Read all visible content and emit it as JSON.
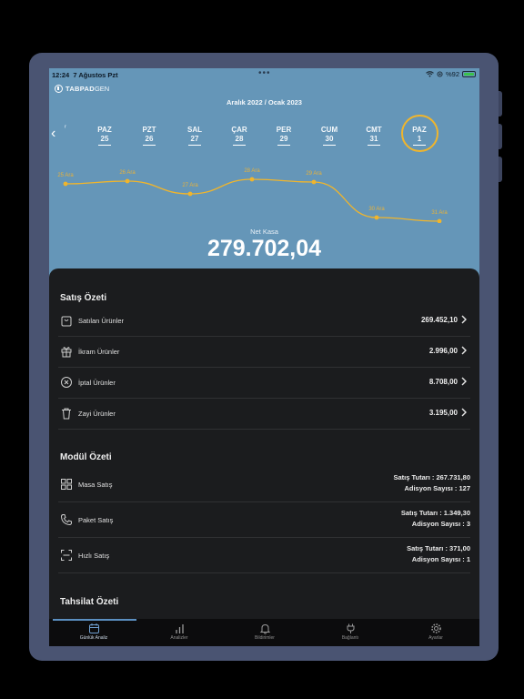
{
  "status_bar": {
    "time": "12:24",
    "date": "7 Ağustos Pzt",
    "battery": "%92",
    "more_dots": "•••"
  },
  "brand": {
    "logo_bold": "TABPAD",
    "logo_light": "GEN"
  },
  "header": {
    "period": "Aralık 2022 / Ocak 2023"
  },
  "days": [
    {
      "name": "",
      "num": "",
      "partial": "ʳ"
    },
    {
      "name": "PAZ",
      "num": "25"
    },
    {
      "name": "PZT",
      "num": "26"
    },
    {
      "name": "SAL",
      "num": "27"
    },
    {
      "name": "ÇAR",
      "num": "28"
    },
    {
      "name": "PER",
      "num": "29"
    },
    {
      "name": "CUM",
      "num": "30"
    },
    {
      "name": "CMT",
      "num": "31"
    },
    {
      "name": "PAZ",
      "num": "1",
      "selected": true
    }
  ],
  "trend_labels": [
    "25 Ara",
    "26 Ara",
    "27 Ara",
    "28 Ara",
    "29 Ara",
    "30 Ara",
    "31 Ara"
  ],
  "net_kasa": {
    "label": "Net Kasa",
    "value": "279.702,04"
  },
  "sales_summary": {
    "title": "Satış Özeti",
    "items": [
      {
        "label": "Satılan Ürünler",
        "value": "269.452,10",
        "icon": "shopping-bag-icon"
      },
      {
        "label": "İkram Ürünler",
        "value": "2.996,00",
        "icon": "gift-icon"
      },
      {
        "label": "İptal Ürünler",
        "value": "8.708,00",
        "icon": "cancel-circle-icon"
      },
      {
        "label": "Zayi Ürünler",
        "value": "3.195,00",
        "icon": "trash-icon"
      }
    ]
  },
  "module_summary": {
    "title": "Modül Özeti",
    "items": [
      {
        "label": "Masa Satış",
        "line1": "Satış Tutarı : 267.731,80",
        "line2": "Adisyon Sayısı : 127",
        "icon": "grid-icon"
      },
      {
        "label": "Paket Satış",
        "line1": "Satış Tutarı : 1.349,30",
        "line2": "Adisyon Sayısı : 3",
        "icon": "phone-icon"
      },
      {
        "label": "Hızlı Satış",
        "line1": "Satış Tutarı : 371,00",
        "line2": "Adisyon Sayısı : 1",
        "icon": "scan-icon"
      }
    ]
  },
  "collection_summary": {
    "title": "Tahsilat Özeti"
  },
  "tabs": [
    {
      "label": "Günlük Analiz",
      "icon": "calendar-icon",
      "active": true
    },
    {
      "label": "Analizler",
      "icon": "bar-chart-icon"
    },
    {
      "label": "Bildirimler",
      "icon": "bell-icon"
    },
    {
      "label": "Bağlantı",
      "icon": "plug-icon"
    },
    {
      "label": "Ayarlar",
      "icon": "gear-icon"
    }
  ],
  "colors": {
    "header_bg": "#6596b8",
    "sheet_bg": "#1b1c1e",
    "accent": "#f0b52c",
    "tab_indicator": "#5b8fc0"
  }
}
